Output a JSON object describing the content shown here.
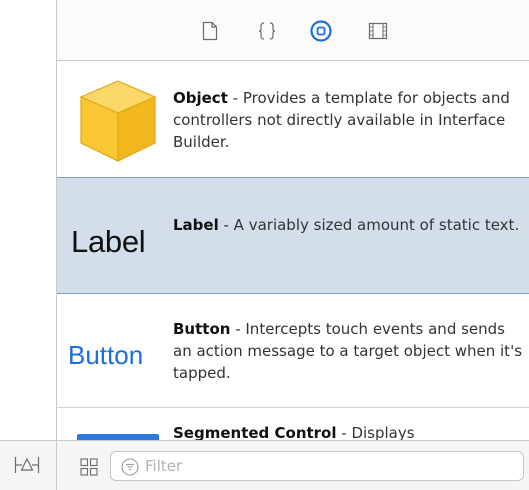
{
  "inspector_tabs": [
    {
      "name": "file-template-icon",
      "selected": false
    },
    {
      "name": "code-snippet-icon",
      "selected": false
    },
    {
      "name": "object-library-icon",
      "selected": true
    },
    {
      "name": "media-library-icon",
      "selected": false
    }
  ],
  "library": {
    "items": [
      {
        "title": "Object",
        "description": " - Provides a template for objects and controllers not directly available in Interface Builder.",
        "preview": "cube-icon"
      },
      {
        "title": "Label",
        "description": " - A variably sized amount of static text.",
        "preview_text": "Label",
        "selected": true
      },
      {
        "title": "Button",
        "description": " - Intercepts touch events and sends an action message to a target object when it's tapped.",
        "preview_text": "Button"
      },
      {
        "title": "Segmented Control",
        "description": " - Displays"
      }
    ]
  },
  "bottom_bar": {
    "filter_placeholder": "Filter",
    "filter_value": ""
  },
  "colors": {
    "accent": "#1a6fe0",
    "selection_bg": "#d3deea",
    "cube": "#f8c733"
  }
}
